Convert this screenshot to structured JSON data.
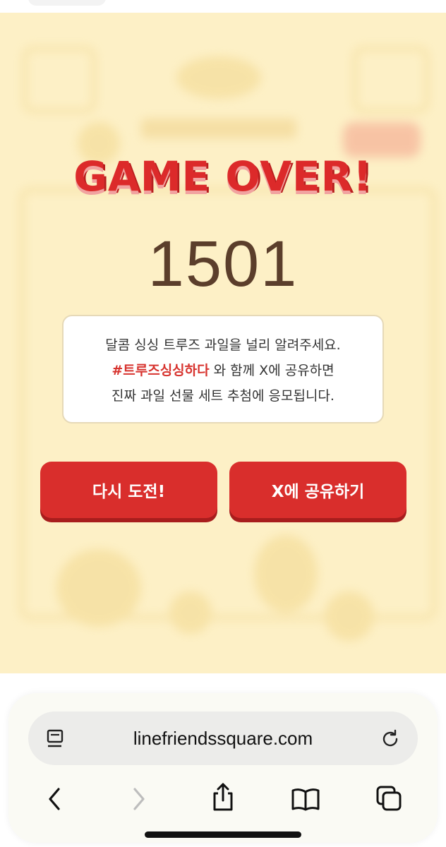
{
  "game": {
    "title": "GAME OVER!",
    "score": "1501",
    "message": {
      "line1": "달콤 싱싱 트루즈 과일을 널리 알려주세요.",
      "hashtag": "#트루즈싱싱하다",
      "line2_rest": " 와 함께 X에 공유하면",
      "line3": "진짜 과일 선물 세트 추첨에 응모됩니다."
    },
    "buttons": {
      "retry": "다시 도전!",
      "share": "X에 공유하기"
    }
  },
  "browser": {
    "url": "linefriendssquare.com",
    "icons": [
      "reader-icon",
      "reload-icon",
      "back-icon",
      "forward-icon",
      "share-icon",
      "bookmarks-icon",
      "tabs-icon"
    ]
  },
  "colors": {
    "background": "#fdf0c6",
    "accent_red": "#d92e2c",
    "score_brown": "#5b3e2b"
  }
}
